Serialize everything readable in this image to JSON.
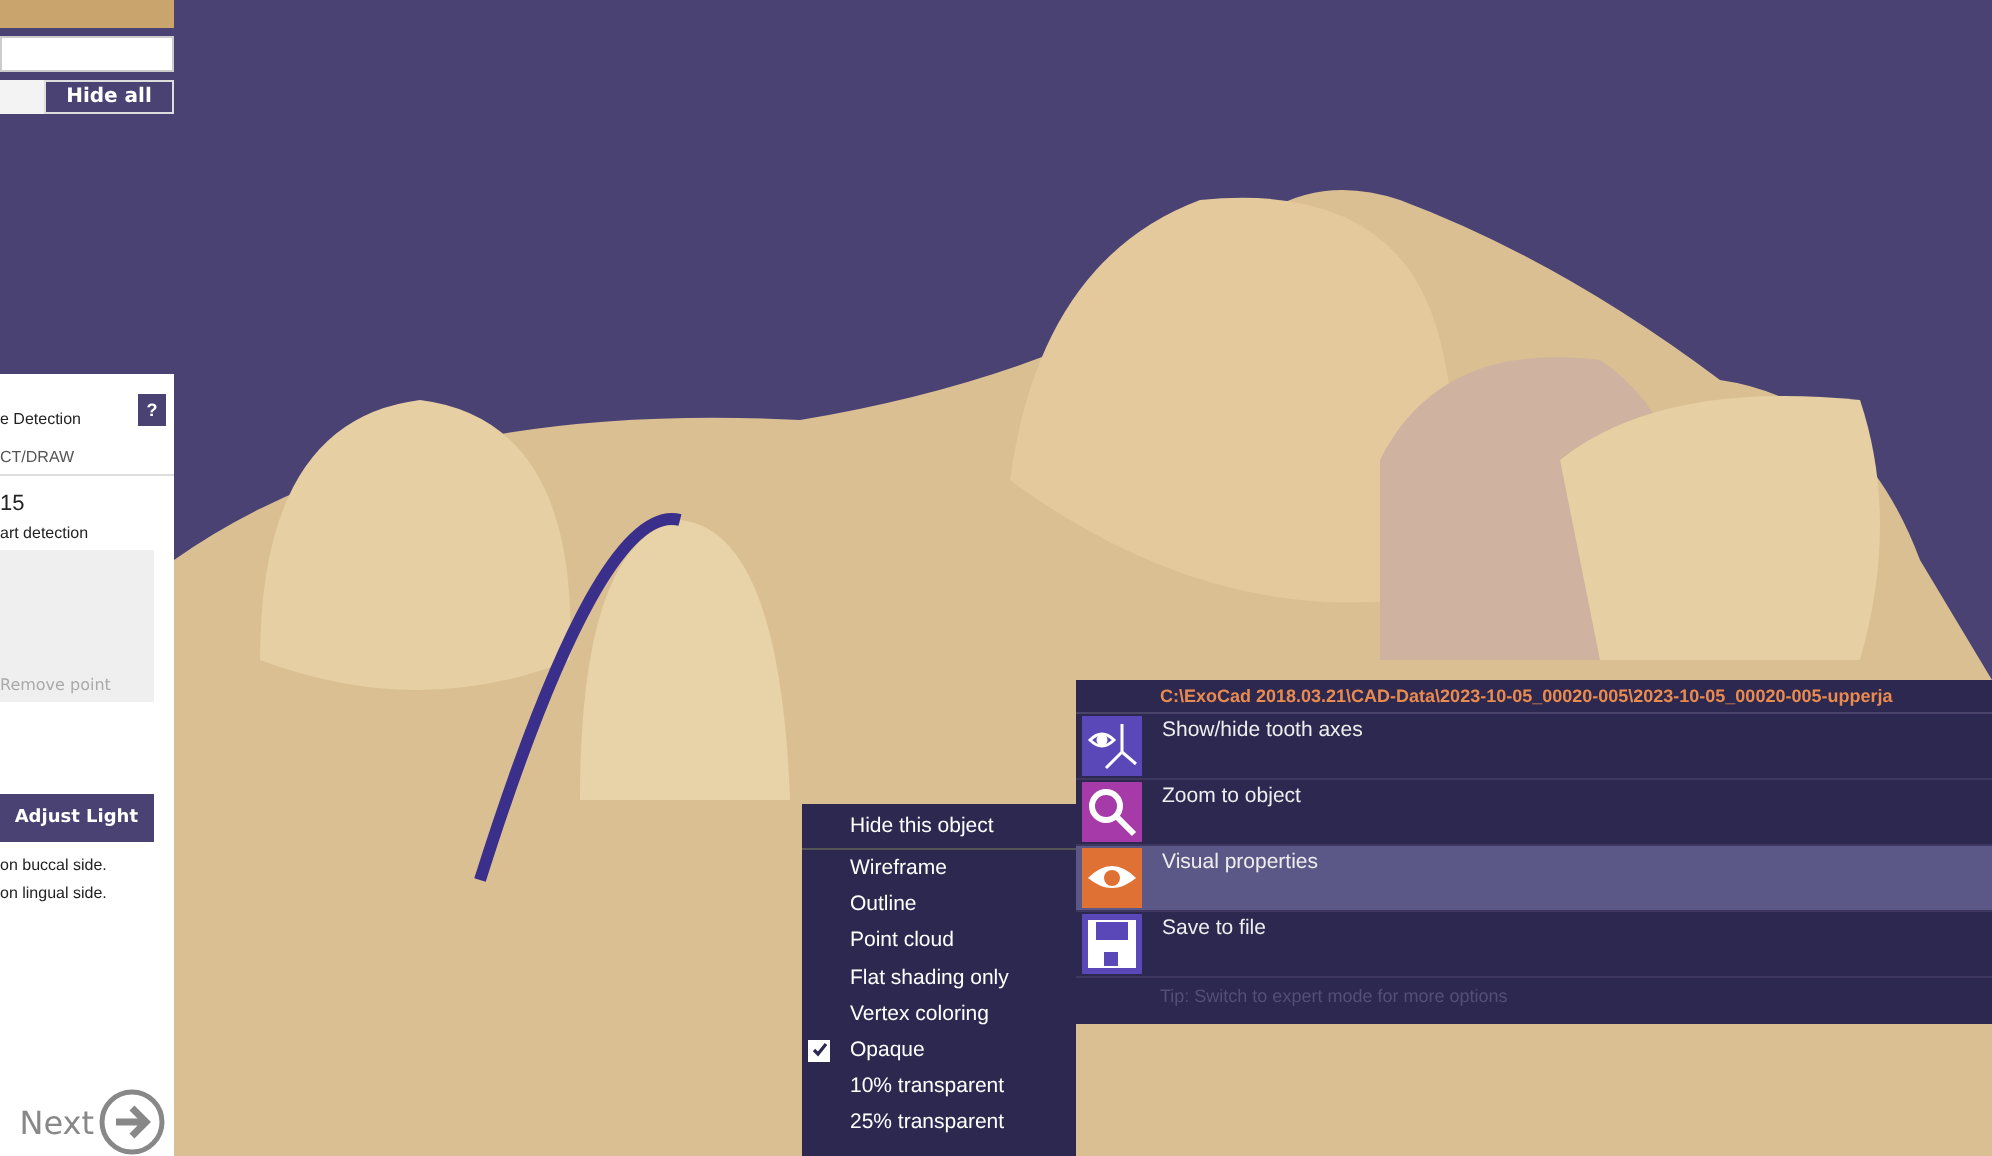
{
  "top_panel": {
    "button": "Hide all"
  },
  "detection_panel": {
    "title": "e Detection",
    "help": "?",
    "tab": "CT/DRAW",
    "value": "15",
    "label": "art detection",
    "remove_button": "Remove point",
    "light_button": "Adjust Light",
    "notes": [
      "on buccal side.",
      "on lingual side."
    ],
    "next_button": "Next"
  },
  "object_menu": {
    "header": "Hide this object",
    "items": [
      {
        "label": "Wireframe",
        "checked": false
      },
      {
        "label": "Outline",
        "checked": false
      },
      {
        "label": "Point cloud",
        "checked": false
      },
      {
        "label": "Flat shading only",
        "checked": false
      },
      {
        "label": "Vertex coloring",
        "checked": false
      },
      {
        "label": "Opaque",
        "checked": true
      },
      {
        "label": "10% transparent",
        "checked": false
      },
      {
        "label": "25% transparent",
        "checked": false
      }
    ]
  },
  "context_menu": {
    "path": "C:\\ExoCad 2018.03.21\\CAD-Data\\2023-10-05_00020-005\\2023-10-05_00020-005-upperja",
    "items": [
      {
        "label": "Show/hide tooth axes",
        "kind": "axes",
        "color": "#5a48b8",
        "selected": false
      },
      {
        "label": "Zoom to object",
        "kind": "zoom",
        "color": "#a63aa8",
        "selected": false
      },
      {
        "label": "Visual properties",
        "kind": "eye",
        "color": "#e07134",
        "selected": true
      },
      {
        "label": "Save to file",
        "kind": "save",
        "color": "#5a48b8",
        "selected": false
      }
    ],
    "tip": "Tip: Switch to expert mode for more options"
  }
}
